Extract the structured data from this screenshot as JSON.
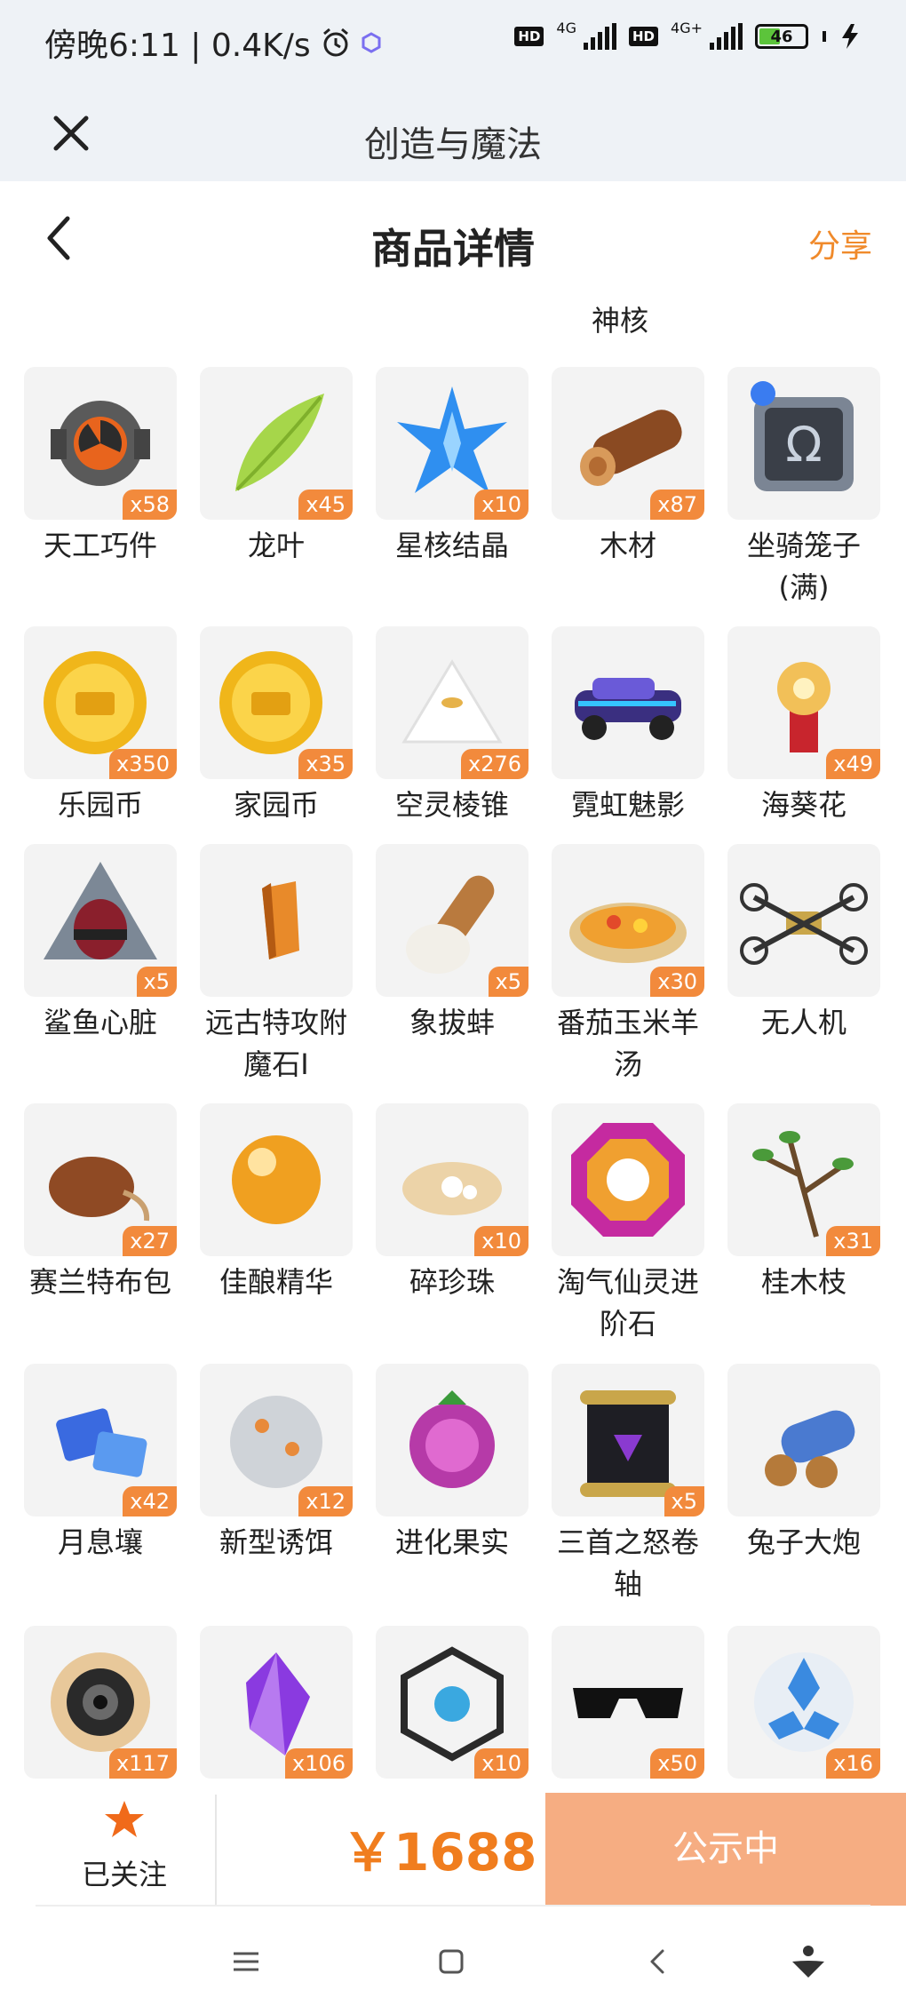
{
  "status_bar": {
    "time": "傍晚6:11 | 0.4K/s",
    "alarm_icon": "alarm-clock-icon",
    "app_icon": "hexagon-icon",
    "hd1": "HD",
    "net1": "4G",
    "hd2": "HD",
    "net2": "4G+",
    "battery": "46",
    "battery_level": 0.46,
    "charging_icon": "bolt-icon"
  },
  "title_bar": {
    "title": "创造与魔法",
    "close_icon": "close-icon"
  },
  "header": {
    "title": "商品详情",
    "share": "分享",
    "back_icon": "chevron-left-icon"
  },
  "partial_row": {
    "labels": [
      "",
      "",
      "",
      "",
      ""
    ],
    "second_line": [
      "",
      "",
      "",
      "神核",
      ""
    ]
  },
  "items": [
    {
      "name": "天工巧件",
      "qty": "x58",
      "icon": "gear-part-icon"
    },
    {
      "name": "龙叶",
      "qty": "x45",
      "icon": "leaf-icon"
    },
    {
      "name": "星核结晶",
      "qty": "x10",
      "icon": "star-crystal-icon"
    },
    {
      "name": "木材",
      "qty": "x87",
      "icon": "log-icon"
    },
    {
      "name": "坐骑笼子(满)",
      "line1": "坐骑笼子",
      "line2": "(满)",
      "qty": "",
      "icon": "cage-icon"
    },
    {
      "name": "乐园币",
      "qty": "x350",
      "icon": "gold-coin-icon"
    },
    {
      "name": "家园币",
      "qty": "x35",
      "icon": "gold-coin-icon"
    },
    {
      "name": "空灵棱锥",
      "qty": "x276",
      "icon": "pyramid-icon"
    },
    {
      "name": "霓虹魅影",
      "qty": "",
      "icon": "neon-car-icon"
    },
    {
      "name": "海葵花",
      "qty": "x49",
      "icon": "anemone-flower-icon"
    },
    {
      "name": "鲨鱼心脏",
      "qty": "x5",
      "icon": "shark-heart-icon"
    },
    {
      "name": "远古特攻附魔石I",
      "line1": "远古特攻附",
      "line2": "魔石I",
      "qty": "",
      "icon": "ancient-stone-icon"
    },
    {
      "name": "象拔蚌",
      "qty": "x5",
      "icon": "geoduck-icon"
    },
    {
      "name": "番茄玉米羊汤",
      "line1": "番茄玉米羊",
      "line2": "汤",
      "qty": "x30",
      "icon": "soup-bowl-icon"
    },
    {
      "name": "无人机",
      "qty": "",
      "icon": "drone-icon"
    },
    {
      "name": "赛兰特布包",
      "qty": "x27",
      "icon": "cloth-bag-icon"
    },
    {
      "name": "佳酿精华",
      "qty": "",
      "icon": "orb-icon"
    },
    {
      "name": "碎珍珠",
      "qty": "x10",
      "icon": "pearl-shell-icon"
    },
    {
      "name": "淘气仙灵进阶石",
      "line1": "淘气仙灵进",
      "line2": "阶石",
      "qty": "",
      "icon": "octagon-gem-icon"
    },
    {
      "name": "桂木枝",
      "qty": "x31",
      "icon": "branch-icon"
    },
    {
      "name": "月息壤",
      "qty": "x42",
      "icon": "blue-soil-icon"
    },
    {
      "name": "新型诱饵",
      "qty": "x12",
      "icon": "bait-ball-icon"
    },
    {
      "name": "进化果实",
      "qty": "",
      "icon": "berry-icon"
    },
    {
      "name": "三首之怒卷轴",
      "line1": "三首之怒卷",
      "line2": "轴",
      "qty": "x5",
      "icon": "scroll-icon"
    },
    {
      "name": "兔子大炮",
      "qty": "",
      "icon": "cannon-icon"
    },
    {
      "name": "",
      "qty": "x117",
      "icon": "vortex-sun-icon"
    },
    {
      "name": "",
      "qty": "x106",
      "icon": "purple-crystal-icon"
    },
    {
      "name": "",
      "qty": "x10",
      "icon": "cage-cube-icon"
    },
    {
      "name": "",
      "qty": "x50",
      "icon": "sunglasses-icon"
    },
    {
      "name": "",
      "qty": "x16",
      "icon": "blue-emblem-icon"
    }
  ],
  "bottom_bar": {
    "follow_label": "已关注",
    "follow_icon": "star-icon",
    "price": "￥1688",
    "status_button": "公示中"
  },
  "nav_bar": {
    "menu_icon": "menu-icon",
    "home_icon": "square-icon",
    "back_icon": "back-triangle-icon",
    "assist_icon": "assistant-icon"
  },
  "colors": {
    "accent": "#f08a2b",
    "qty_badge": "#f28a3c",
    "status_button": "#f6ad82",
    "header_bg": "#eef2f6"
  }
}
